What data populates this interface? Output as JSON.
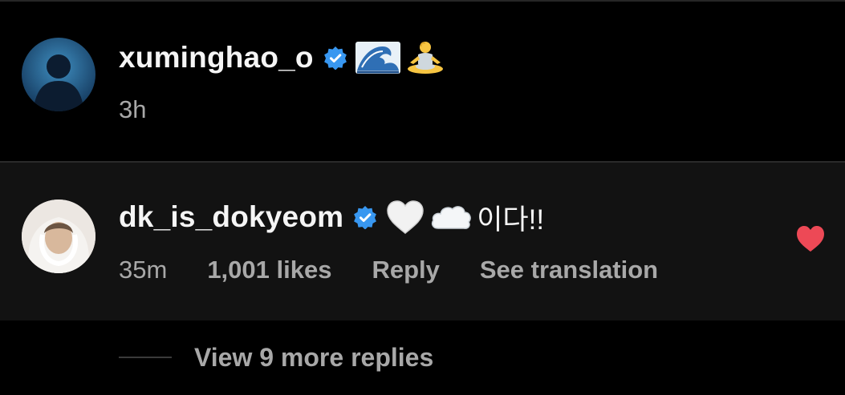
{
  "comments": [
    {
      "username": "xuminghao_o",
      "verified": true,
      "emojis": [
        "water-wave-emoji",
        "person-in-lotus-position-emoji"
      ],
      "text": "",
      "time": "3h"
    },
    {
      "username": "dk_is_dokyeom",
      "verified": true,
      "emojis": [
        "white-heart-emoji",
        "cloud-emoji"
      ],
      "text": "이다!!",
      "time": "35m",
      "likes": "1,001 likes",
      "reply_label": "Reply",
      "translate_label": "See translation",
      "liked": true
    }
  ],
  "view_replies_label": "View 9 more replies",
  "colors": {
    "background": "#000000",
    "highlight_row": "#121212",
    "verified_blue": "#3897f0",
    "like_red": "#ed4956",
    "meta_gray": "#a8a8a8"
  }
}
